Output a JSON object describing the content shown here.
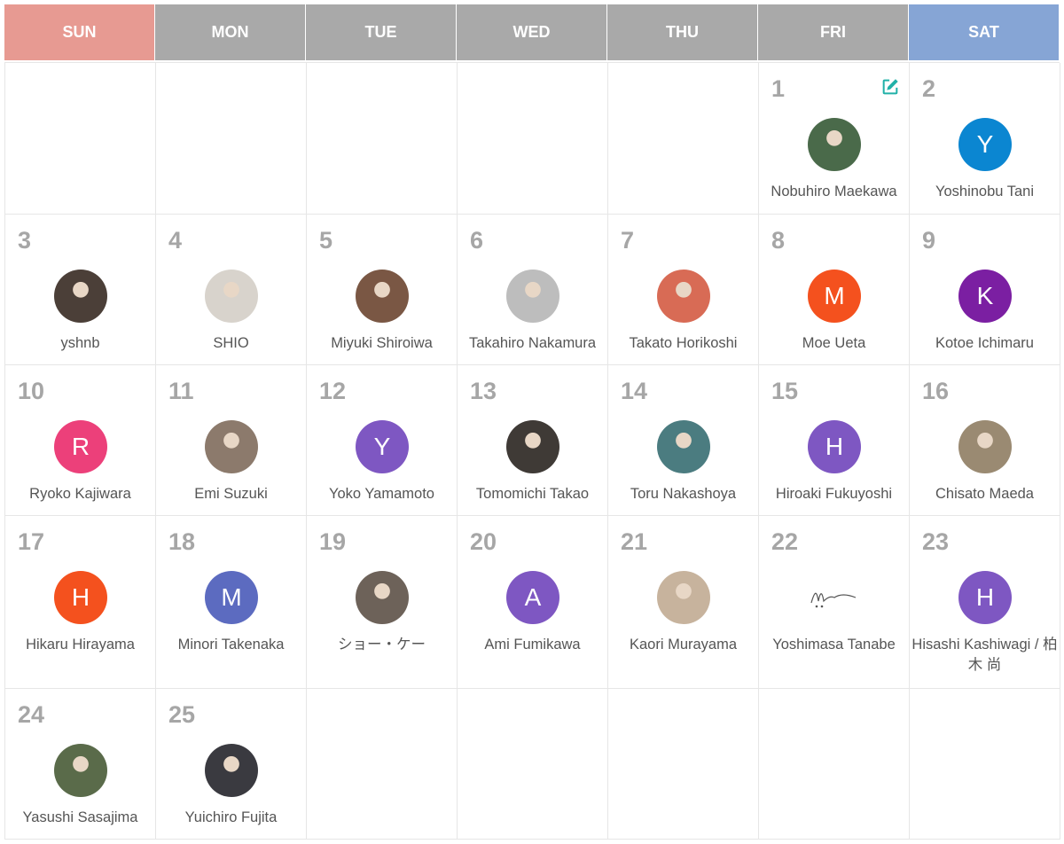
{
  "weekdays": [
    "SUN",
    "MON",
    "TUE",
    "WED",
    "THU",
    "FRI",
    "SAT"
  ],
  "colors": {
    "sun": "#e79a92",
    "sat": "#86a5d5",
    "weekday": "#a9a9a9",
    "accent": "#21b1a8"
  },
  "edit_icon": "edit-icon",
  "cells": [
    {
      "day": "",
      "name": ""
    },
    {
      "day": "",
      "name": ""
    },
    {
      "day": "",
      "name": ""
    },
    {
      "day": "",
      "name": ""
    },
    {
      "day": "",
      "name": ""
    },
    {
      "day": "1",
      "name": "Nobuhiro Maekawa",
      "avatar": "photo",
      "photo": "#4a6a4a"
    },
    {
      "day": "2",
      "name": "Yoshinobu Tani",
      "avatar": "letter",
      "letter": "Y",
      "color": "#0b86d1"
    },
    {
      "day": "3",
      "name": "yshnb",
      "avatar": "photo",
      "photo": "#4b3f38"
    },
    {
      "day": "4",
      "name": "SHIO",
      "avatar": "photo",
      "photo": "#d8d3cc"
    },
    {
      "day": "5",
      "name": "Miyuki Shiroiwa",
      "avatar": "photo",
      "photo": "#7a5744"
    },
    {
      "day": "6",
      "name": "Takahiro Nakamura",
      "avatar": "photo",
      "photo": "#bdbdbd"
    },
    {
      "day": "7",
      "name": "Takato Horikoshi",
      "avatar": "photo",
      "photo": "#d86b55"
    },
    {
      "day": "8",
      "name": "Moe Ueta",
      "avatar": "letter",
      "letter": "M",
      "color": "#f4511e"
    },
    {
      "day": "9",
      "name": "Kotoe Ichimaru",
      "avatar": "letter",
      "letter": "K",
      "color": "#7b1fa2"
    },
    {
      "day": "10",
      "name": "Ryoko Kajiwara",
      "avatar": "letter",
      "letter": "R",
      "color": "#ec407a"
    },
    {
      "day": "11",
      "name": "Emi Suzuki",
      "avatar": "photo",
      "photo": "#8c7a6c"
    },
    {
      "day": "12",
      "name": "Yoko Yamamoto",
      "avatar": "letter",
      "letter": "Y",
      "color": "#7e57c2"
    },
    {
      "day": "13",
      "name": "Tomomichi Takao",
      "avatar": "photo",
      "photo": "#3f3a36"
    },
    {
      "day": "14",
      "name": "Toru Nakashoya",
      "avatar": "photo",
      "photo": "#4b7c80"
    },
    {
      "day": "15",
      "name": "Hiroaki Fukuyoshi",
      "avatar": "letter",
      "letter": "H",
      "color": "#7e57c2"
    },
    {
      "day": "16",
      "name": "Chisato Maeda",
      "avatar": "photo",
      "photo": "#9a8a72"
    },
    {
      "day": "17",
      "name": "Hikaru Hirayama",
      "avatar": "letter",
      "letter": "H",
      "color": "#f4511e"
    },
    {
      "day": "18",
      "name": "Minori Takenaka",
      "avatar": "letter",
      "letter": "M",
      "color": "#5c6bc0"
    },
    {
      "day": "19",
      "name": "ショー・ケー",
      "avatar": "photo",
      "photo": "#6d6259"
    },
    {
      "day": "20",
      "name": "Ami Fumikawa",
      "avatar": "letter",
      "letter": "A",
      "color": "#7e57c2"
    },
    {
      "day": "21",
      "name": "Kaori Murayama",
      "avatar": "photo",
      "photo": "#c7b39d"
    },
    {
      "day": "22",
      "name": "Yoshimasa Tanabe",
      "avatar": "signature"
    },
    {
      "day": "23",
      "name": "Hisashi Kashiwagi / 柏木 尚",
      "avatar": "letter",
      "letter": "H",
      "color": "#7e57c2"
    },
    {
      "day": "24",
      "name": "Yasushi Sasajima",
      "avatar": "photo",
      "photo": "#5a6b4a"
    },
    {
      "day": "25",
      "name": "Yuichiro Fujita",
      "avatar": "photo",
      "photo": "#3a3a40"
    },
    {
      "day": "",
      "name": ""
    },
    {
      "day": "",
      "name": ""
    },
    {
      "day": "",
      "name": ""
    },
    {
      "day": "",
      "name": ""
    },
    {
      "day": "",
      "name": ""
    }
  ]
}
